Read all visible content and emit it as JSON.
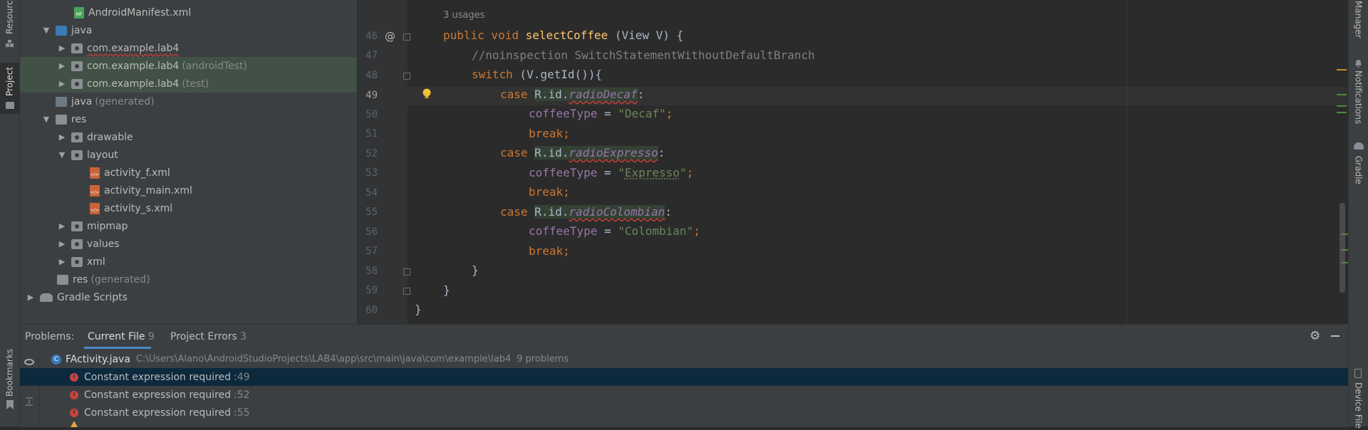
{
  "left_strip": {
    "resource": "Resourc",
    "project": "Project",
    "bookmarks": "Bookmarks"
  },
  "right_strip": {
    "manager": "Manager",
    "notifications": "Notifications",
    "gradle": "Gradle",
    "device": "Device File"
  },
  "tree": [
    {
      "label": "AndroidManifest.xml",
      "suffix": ""
    },
    {
      "label": "java",
      "suffix": ""
    },
    {
      "label": "com.example.lab4",
      "suffix": ""
    },
    {
      "label": "com.example.lab4",
      "suffix": "(androidTest)"
    },
    {
      "label": "com.example.lab4",
      "suffix": "(test)"
    },
    {
      "label": "java",
      "suffix": "(generated)"
    },
    {
      "label": "res",
      "suffix": ""
    },
    {
      "label": "drawable",
      "suffix": ""
    },
    {
      "label": "layout",
      "suffix": ""
    },
    {
      "label": "activity_f.xml",
      "suffix": ""
    },
    {
      "label": "activity_main.xml",
      "suffix": ""
    },
    {
      "label": "activity_s.xml",
      "suffix": ""
    },
    {
      "label": "mipmap",
      "suffix": ""
    },
    {
      "label": "values",
      "suffix": ""
    },
    {
      "label": "xml",
      "suffix": ""
    },
    {
      "label": "res",
      "suffix": "(generated)"
    },
    {
      "label": "Gradle Scripts",
      "suffix": ""
    }
  ],
  "editor": {
    "usages": "3 usages",
    "lines": [
      "46",
      "47",
      "48",
      "49",
      "50",
      "51",
      "52",
      "53",
      "54",
      "55",
      "56",
      "57",
      "58",
      "59",
      "60"
    ],
    "code": {
      "l46": {
        "a": "public void ",
        "b": "selectCoffee",
        "c": " (View V) {"
      },
      "l47": "//noinspection SwitchStatementWithoutDefaultBranch",
      "l48": {
        "a": "switch",
        "b": " (V.getId()){"
      },
      "l49": {
        "a": "case ",
        "b": "R",
        "c": ".id.",
        "d": "radioDecaf",
        "e": ":"
      },
      "l50": {
        "a": "coffeeType",
        "b": " = ",
        "c": "\"Decaf\"",
        "d": ";"
      },
      "l51": {
        "a": "break",
        "b": ";"
      },
      "l52": {
        "a": "case ",
        "b": "R",
        "c": ".id.",
        "d": "radioExpresso",
        "e": ":"
      },
      "l53": {
        "a": "coffeeType",
        "b": " = ",
        "c": "\"",
        "d": "Expresso",
        "e": "\"",
        ";": ";"
      },
      "l54": {
        "a": "break",
        "b": ";"
      },
      "l55": {
        "a": "case ",
        "b": "R",
        "c": ".id.",
        "d": "radioColombian",
        "e": ":"
      },
      "l56": {
        "a": "coffeeType",
        "b": " = ",
        "c": "\"Colombian\"",
        "d": ";"
      },
      "l57": {
        "a": "break",
        "b": ";"
      },
      "l58": "}",
      "l59": "}",
      "l60": "}"
    },
    "at_marker": "@"
  },
  "problems": {
    "label": "Problems:",
    "tab_current": "Current File",
    "tab_current_count": "9",
    "tab_project": "Project Errors",
    "tab_project_count": "3",
    "file": "FActivity.java",
    "path": "C:\\Users\\Alano\\AndroidStudioProjects\\LAB4\\app\\src\\main\\java\\com\\example\\lab4",
    "count": "9 problems",
    "items": [
      {
        "text": "Constant expression required",
        "line": ":49"
      },
      {
        "text": "Constant expression required",
        "line": ":52"
      },
      {
        "text": "Constant expression required",
        "line": ":55"
      }
    ]
  }
}
